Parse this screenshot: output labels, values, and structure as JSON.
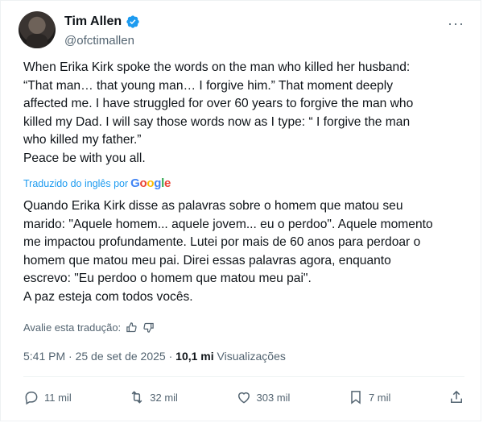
{
  "author": {
    "name": "Tim Allen",
    "handle": "@ofctimallen",
    "verified": true
  },
  "post": {
    "original_lines": [
      "When Erika Kirk spoke the words on the man who killed her husband:",
      "“That man… that young man… I forgive him.”  That moment deeply",
      "affected me.  I have struggled for over 60 years to forgive the man who",
      "killed my Dad. I will say those words now as I type: “ I forgive the man",
      "who killed my father.”",
      "Peace be with you all."
    ],
    "translated_by": "Traduzido do inglês por",
    "translated_by_brand": "Google",
    "translation_lines": [
      "Quando Erika Kirk disse as palavras sobre o homem que matou seu",
      "marido: \"Aquele homem... aquele jovem... eu o perdoo\". Aquele momento",
      "me impactou profundamente. Lutei por mais de 60 anos para perdoar o",
      "homem que matou meu pai. Direi essas palavras agora, enquanto",
      "escrevo: \"Eu perdoo o homem que matou meu pai\".",
      "A paz esteja com todos vocês."
    ],
    "rate_label": "Avalie esta tradução:"
  },
  "meta": {
    "time": "5:41 PM",
    "separator": "·",
    "date": "25 de set de 2025",
    "views": "10,1 mi",
    "views_label": "Visualizações"
  },
  "actions": {
    "replies": "11 mil",
    "reposts": "32 mil",
    "likes": "303 mil",
    "bookmarks": "7 mil"
  },
  "colors": {
    "accent": "#1d9bf0",
    "secondary_text": "#536471",
    "text": "#0f1419"
  },
  "icons": [
    "verified-badge-icon",
    "more-icon",
    "thumbs-up-icon",
    "thumbs-down-icon",
    "reply-icon",
    "repost-icon",
    "like-icon",
    "bookmark-icon",
    "share-icon"
  ]
}
